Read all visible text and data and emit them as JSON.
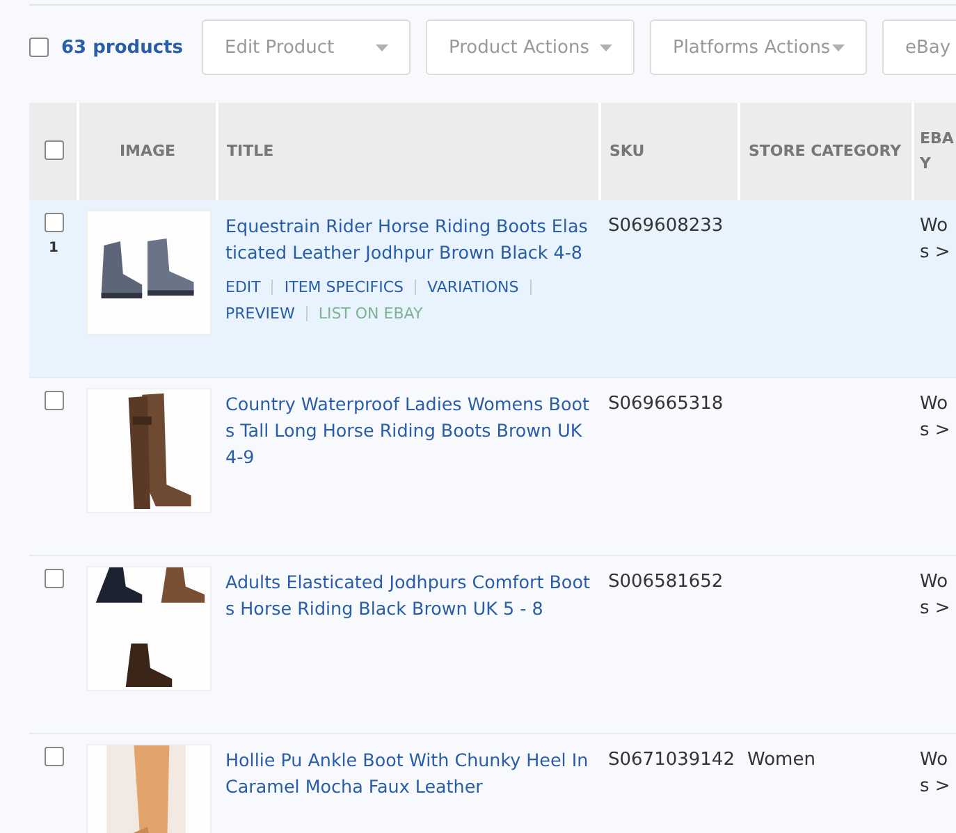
{
  "toolbar": {
    "select_all": {
      "checked": false
    },
    "count": "63 products",
    "dropdowns": [
      {
        "label": "Edit Product",
        "caret": true
      },
      {
        "label": "Product Actions",
        "caret": true
      },
      {
        "label": "Platforms Actions",
        "caret": true
      },
      {
        "label": "eBay",
        "caret": false
      }
    ]
  },
  "table": {
    "header_checkbox": {
      "checked": false
    },
    "columns": [
      "IMAGE",
      "TITLE",
      "SKU",
      "STORE CATEGORY",
      "EBAY"
    ],
    "rows": [
      {
        "selected": true,
        "checked": false,
        "index": "1",
        "title": "Equestrain Rider Horse Riding Boots Elasticated Leather Jodhpur Brown Black 4-8",
        "actions": [
          {
            "label": "EDIT",
            "kind": "link"
          },
          {
            "label": "ITEM SPECIFICS",
            "kind": "link"
          },
          {
            "label": "VARIATIONS",
            "kind": "link"
          },
          {
            "label": "PREVIEW",
            "kind": "link"
          },
          {
            "label": "LIST ON EBAY",
            "kind": "platform"
          }
        ],
        "sku": "S069608233",
        "ebay_lines": [
          "Wo",
          "s >"
        ]
      },
      {
        "selected": false,
        "checked": false,
        "title": "Country Waterproof Ladies Womens Boots Tall Long Horse Riding Boots Brown UK 4-9",
        "sku": "S069665318",
        "ebay_lines": [
          "Wo",
          "s >"
        ]
      },
      {
        "selected": false,
        "checked": false,
        "title": "Adults Elasticated Jodhpurs Comfort Boots Horse Riding Black Brown UK 5 - 8",
        "sku": "S006581652",
        "ebay_lines": [
          "Wo",
          "s >"
        ]
      },
      {
        "selected": false,
        "checked": false,
        "title": "Hollie Pu Ankle Boot With Chunky Heel In Caramel Mocha Faux Leather",
        "sku": "S0671039142",
        "store_category": "Women",
        "ebay_lines": [
          "Wo",
          "s >"
        ]
      }
    ]
  }
}
